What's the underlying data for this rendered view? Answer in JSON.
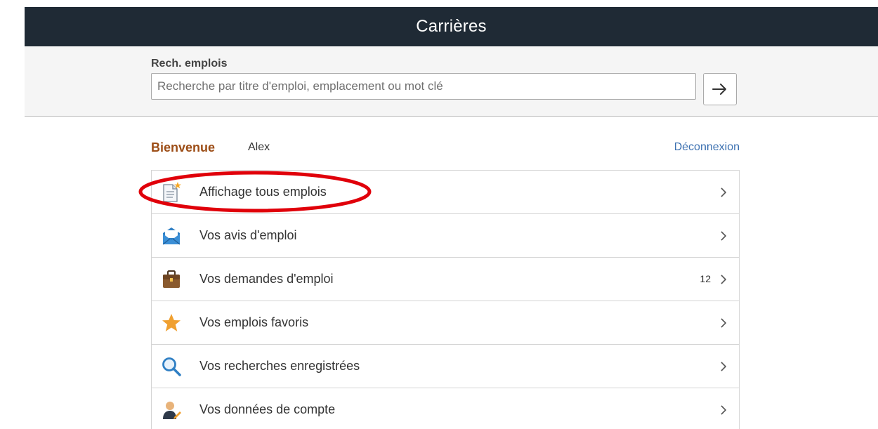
{
  "header": {
    "title": "Carrières"
  },
  "search": {
    "label": "Rech. emplois",
    "placeholder": "Recherche par titre d'emploi, emplacement ou mot clé",
    "value": "",
    "button_icon": "arrow-right-icon"
  },
  "welcome": {
    "greeting": "Bienvenue",
    "user_name": "Alex",
    "logout_label": "Déconnexion"
  },
  "menu": {
    "items": [
      {
        "label": "Affichage tous emplois",
        "icon": "new-document-icon",
        "count": ""
      },
      {
        "label": "Vos avis d'emploi",
        "icon": "envelope-icon",
        "count": ""
      },
      {
        "label": "Vos demandes d'emploi",
        "icon": "briefcase-icon",
        "count": "12"
      },
      {
        "label": "Vos emplois favoris",
        "icon": "star-icon",
        "count": ""
      },
      {
        "label": "Vos recherches enregistrées",
        "icon": "magnifier-icon",
        "count": ""
      },
      {
        "label": "Vos données de compte",
        "icon": "user-edit-icon",
        "count": ""
      }
    ]
  },
  "colors": {
    "header_bg": "#1f2a35",
    "welcome_accent": "#9c4d16",
    "link": "#3a6fb0",
    "annotation": "#e0000a"
  }
}
